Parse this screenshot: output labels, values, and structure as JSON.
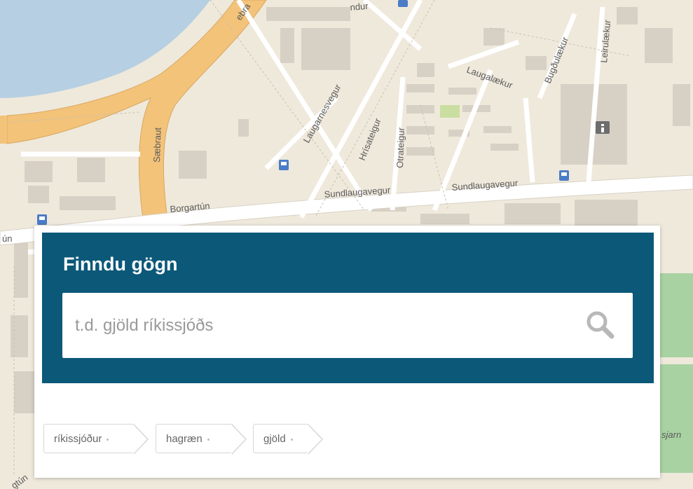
{
  "map": {
    "street_labels": [
      "Borgartún",
      "Sæbraut",
      "Laugarnesvegur",
      "Hrísateigur",
      "Otrateigur",
      "Laugalækur",
      "Bugðulækur",
      "Leirulækur",
      "Sundlaugavegur",
      "Sundlaugavegur",
      "ún",
      "ebra",
      "ndur",
      "sjarn",
      "gtún"
    ]
  },
  "search_panel": {
    "title": "Finndu gögn",
    "placeholder": "t.d. gjöld ríkissjóðs",
    "search_icon": "magnifier-icon"
  },
  "tags": [
    "ríkissjóður",
    "hagræn",
    "gjöld"
  ],
  "colors": {
    "panel": "#0b5878",
    "map_background": "#efe9dc",
    "water": "#b6cfe2",
    "motorway": "#f3c37a",
    "park": "#a8d2a2"
  }
}
